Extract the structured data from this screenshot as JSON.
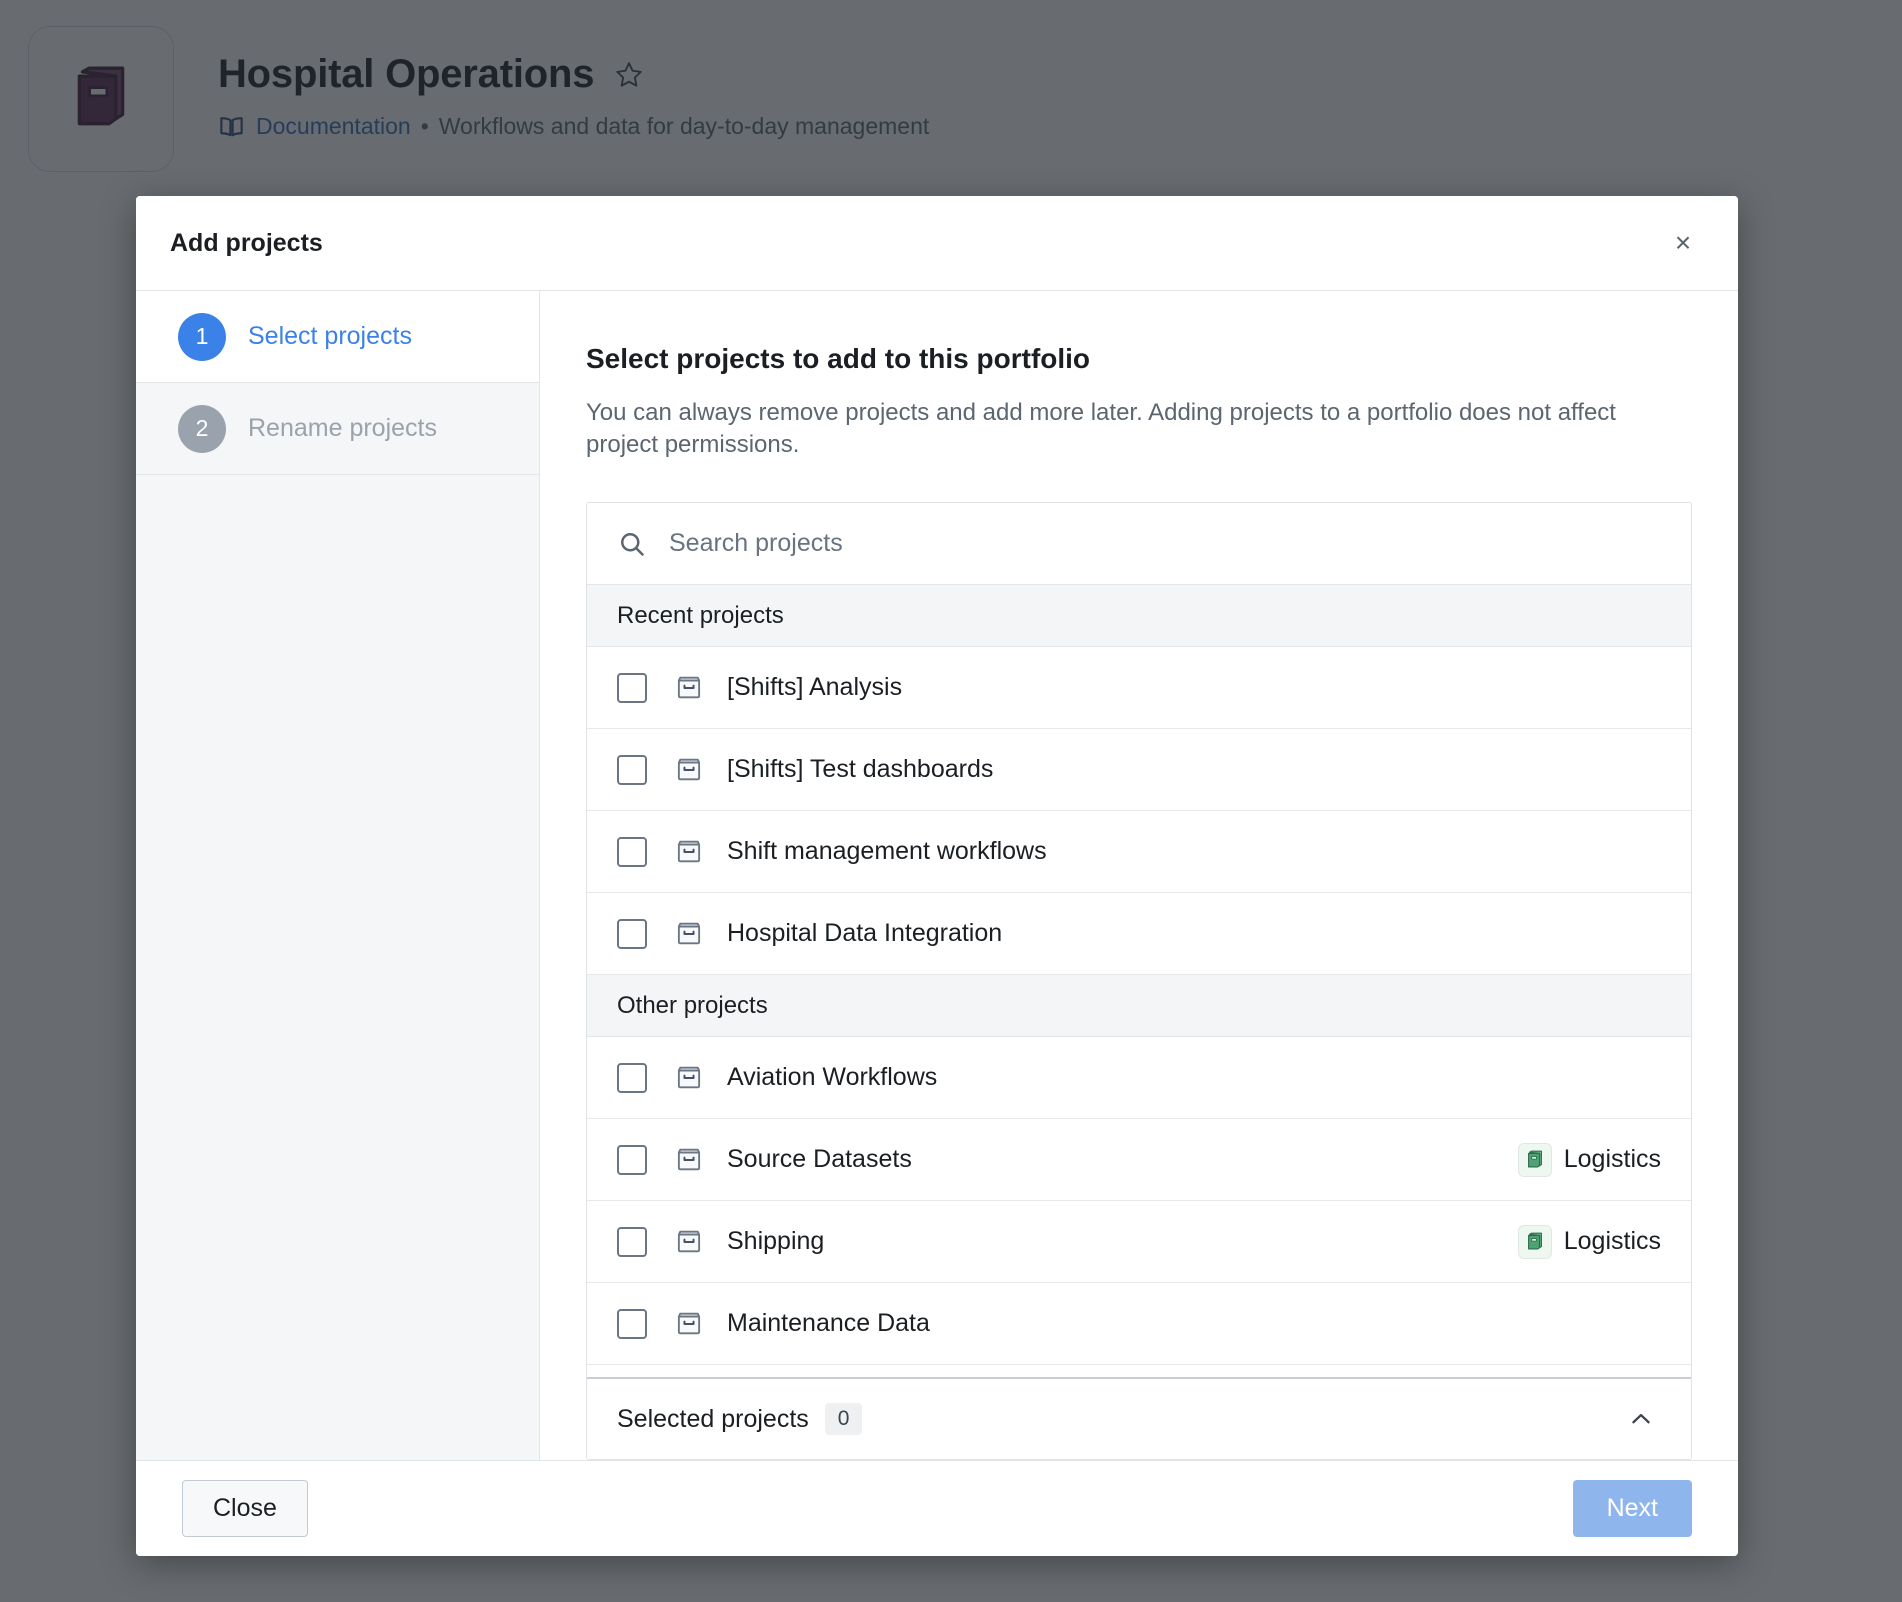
{
  "page": {
    "portfolio_title": "Hospital Operations",
    "doc_link": "Documentation",
    "separator": "•",
    "description": "Workflows and data for day-to-day management"
  },
  "modal": {
    "title": "Add projects",
    "close_symbol": "×",
    "steps": [
      {
        "number": "1",
        "label": "Select projects",
        "state": "active"
      },
      {
        "number": "2",
        "label": "Rename projects",
        "state": "inactive"
      }
    ],
    "panel": {
      "heading": "Select projects to add to this portfolio",
      "description": "You can always remove projects and add more later. Adding projects to a portfolio does not affect project permissions."
    },
    "search": {
      "placeholder": "Search projects",
      "value": ""
    },
    "groups": [
      {
        "title": "Recent projects",
        "projects": [
          {
            "name": "[Shifts] Analysis",
            "checked": false,
            "badge": null
          },
          {
            "name": "[Shifts] Test dashboards",
            "checked": false,
            "badge": null
          },
          {
            "name": "Shift management workflows",
            "checked": false,
            "badge": null
          },
          {
            "name": "Hospital Data Integration",
            "checked": false,
            "badge": null
          }
        ]
      },
      {
        "title": "Other projects",
        "projects": [
          {
            "name": "Aviation Workflows",
            "checked": false,
            "badge": null
          },
          {
            "name": "Source Datasets",
            "checked": false,
            "badge": "Logistics"
          },
          {
            "name": "Shipping",
            "checked": false,
            "badge": "Logistics"
          },
          {
            "name": "Maintenance Data",
            "checked": false,
            "badge": null
          }
        ]
      }
    ],
    "selected": {
      "label": "Selected projects",
      "count": "0"
    },
    "footer": {
      "close_label": "Close",
      "next_label": "Next"
    }
  },
  "colors": {
    "accent_blue": "#3b82e8",
    "next_button": "#8fb6ec",
    "book_purple": "#5e2b57",
    "badge_green": "#4ea373",
    "link_blue": "#2f6fb8",
    "muted_text": "#5c6670"
  },
  "icons": {
    "star": "star-outline-icon",
    "documentation": "open-book-icon",
    "search": "magnifier-icon",
    "project": "project-box-icon",
    "badge": "green-book-icon",
    "collapse": "chevron-up-icon",
    "close": "close-x-icon"
  }
}
